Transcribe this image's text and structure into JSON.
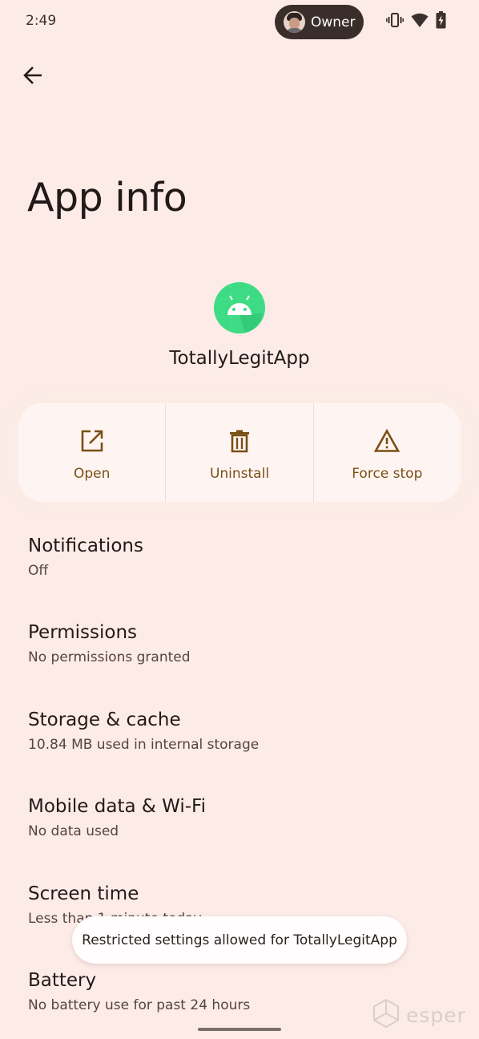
{
  "status_bar": {
    "time": "2:49",
    "user_chip": {
      "label": "Owner"
    },
    "icons": [
      "vibrate-icon",
      "wifi-icon",
      "battery-charging-icon"
    ]
  },
  "header": {
    "back_icon": "arrow-back-icon",
    "title": "App info"
  },
  "app": {
    "name": "TotallyLegitApp",
    "icon": "android-app-icon",
    "icon_color": "#3ddc84"
  },
  "actions": [
    {
      "label": "Open",
      "icon": "open-in-new-icon"
    },
    {
      "label": "Uninstall",
      "icon": "trash-icon"
    },
    {
      "label": "Force stop",
      "icon": "warning-icon"
    }
  ],
  "settings": [
    {
      "title": "Notifications",
      "summary": "Off"
    },
    {
      "title": "Permissions",
      "summary": "No permissions granted"
    },
    {
      "title": "Storage & cache",
      "summary": "10.84 MB used in internal storage"
    },
    {
      "title": "Mobile data & Wi-Fi",
      "summary": "No data used"
    },
    {
      "title": "Screen time",
      "summary": "Less than 1 minute today"
    },
    {
      "title": "Battery",
      "summary": "No battery use for past 24 hours"
    }
  ],
  "toast": {
    "message": "Restricted settings allowed for TotallyLegitApp"
  },
  "watermark": {
    "text": "esper"
  },
  "colors": {
    "background": "#fcebe7",
    "accent": "#7a4f14",
    "chip": "#3a2e2b"
  }
}
